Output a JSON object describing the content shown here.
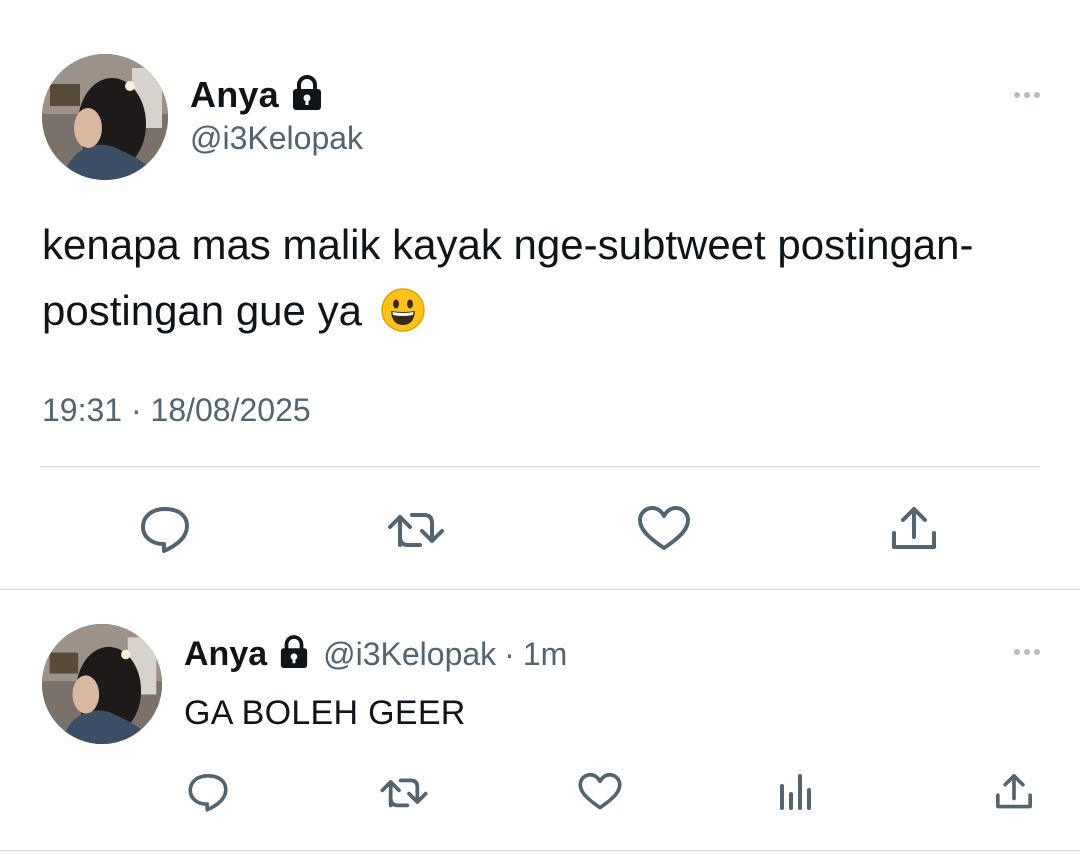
{
  "main_tweet": {
    "author": {
      "name": "Anya",
      "handle": "@i3Kelopak",
      "protected_icon": "lock-icon"
    },
    "text": "kenapa mas malik kayak nge-subtweet postingan-postingan gue ya",
    "emoji": "😃",
    "timestamp": "19:31 · 18/08/2025",
    "actions": [
      "reply-icon",
      "retweet-icon",
      "like-icon",
      "share-icon"
    ]
  },
  "reply_tweet": {
    "author": {
      "name": "Anya",
      "handle": "@i3Kelopak",
      "protected_icon": "lock-icon"
    },
    "separator": "·",
    "time_ago": "1m",
    "text": "GA BOLEH GEER",
    "actions": [
      "reply-icon",
      "retweet-icon",
      "like-icon",
      "views-icon",
      "share-icon"
    ]
  },
  "colors": {
    "text_primary": "#0f1419",
    "text_secondary": "#536471",
    "divider": "#cfd9de",
    "icon": "#536471"
  }
}
